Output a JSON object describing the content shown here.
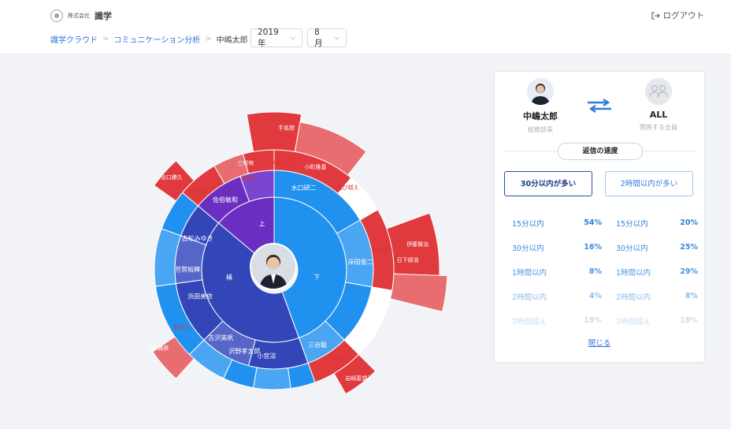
{
  "header": {
    "logo_small": "株式会社",
    "logo_main": "識学",
    "logout_label": "ログアウト"
  },
  "breadcrumb": {
    "root": "識学クラウド",
    "section": "コミュニケーション分析",
    "current": "中嶋太郎"
  },
  "filters": {
    "year": "2019年",
    "month": "8月"
  },
  "chart_data": {
    "type": "sunburst",
    "center": "中嶋太郎",
    "directions": [
      {
        "name": "上",
        "color": "#6a2fc0"
      },
      {
        "name": "横",
        "color": "#3346b8"
      },
      {
        "name": "下",
        "color": "#2191ef"
      },
      {
        "name": "飛び越え",
        "color": "#e03a3e"
      },
      {
        "name": "斜め上",
        "color": "#e03a3e"
      }
    ],
    "people": [
      {
        "name": "三村咲",
        "group": "斜め上"
      },
      {
        "name": "佐伯敏和",
        "group": "上"
      },
      {
        "name": "古松みゆき",
        "group": "横"
      },
      {
        "name": "芳賀裕輝",
        "group": "横"
      },
      {
        "name": "浜田美依",
        "group": "横"
      },
      {
        "name": "古沢美帆",
        "group": "横"
      },
      {
        "name": "水口研二",
        "group": "下"
      },
      {
        "name": "岸田俊二",
        "group": "下"
      },
      {
        "name": "三谷聡",
        "group": "下"
      },
      {
        "name": "小宮涼",
        "group": "下"
      },
      {
        "name": "沢野孝太郎",
        "group": "下"
      },
      {
        "name": "手島努",
        "group": "飛び越え"
      },
      {
        "name": "小町雅基",
        "group": "飛び越え"
      },
      {
        "name": "坂下一代",
        "group": "飛び越え"
      },
      {
        "name": "出口勝久",
        "group": "飛び越え"
      },
      {
        "name": "日下部浩",
        "group": "飛び越え"
      },
      {
        "name": "伊藤賢治",
        "group": "飛び越え"
      },
      {
        "name": "岩崎恵望子",
        "group": "飛び越え"
      },
      {
        "name": "石原雅彦",
        "group": "斜め上"
      }
    ],
    "labels": {
      "up": "上",
      "side": "横",
      "down": "下",
      "skip": "飛び越え",
      "diag": "斜め上"
    }
  },
  "panel": {
    "left_person": {
      "name": "中嶋太郎",
      "role": "総務部長"
    },
    "right_person": {
      "name": "ALL",
      "role": "関係する全員"
    },
    "speed_title": "返信の速度",
    "tab_left": "30分以内が多い",
    "tab_right": "2時間以内が多い",
    "rows": [
      {
        "label": "15分以内",
        "left": "54%",
        "right": "20%",
        "color": "#2f7fd8"
      },
      {
        "label": "30分以内",
        "left": "16%",
        "right": "25%",
        "color": "#3a88dc"
      },
      {
        "label": "1時間以内",
        "left": "8%",
        "right": "29%",
        "color": "#4a95e2"
      },
      {
        "label": "2時間以内",
        "left": "4%",
        "right": "8%",
        "color": "#8dbcec"
      },
      {
        "label": "2時間超え",
        "left": "18%",
        "right": "18%",
        "color": "#c6def5"
      }
    ],
    "close_label": "閉じる"
  }
}
